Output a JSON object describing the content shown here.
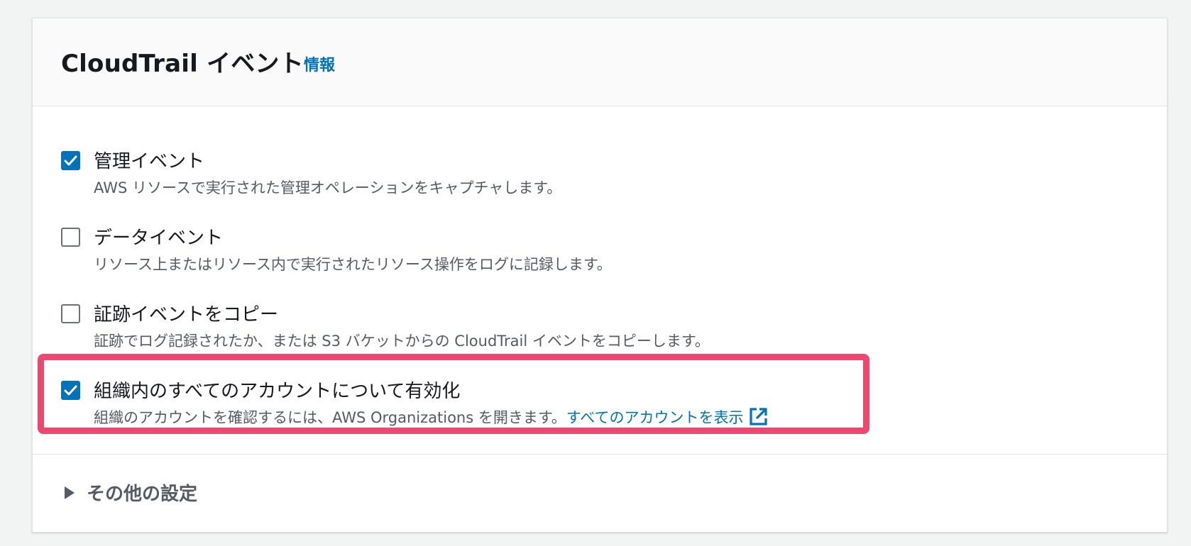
{
  "panel": {
    "title": "CloudTrail イベント",
    "info_link": "情報"
  },
  "options": [
    {
      "label": "管理イベント",
      "description": "AWS リソースで実行された管理オペレーションをキャプチャします。",
      "checked": true
    },
    {
      "label": "データイベント",
      "description": "リソース上またはリソース内で実行されたリソース操作をログに記録します。",
      "checked": false
    },
    {
      "label": "証跡イベントをコピー",
      "description": "証跡でログ記録されたか、または S3 バケットからの CloudTrail イベントをコピーします。",
      "checked": false
    },
    {
      "label": "組織内のすべてのアカウントについて有効化",
      "description": "組織のアカウントを確認するには、AWS Organizations を開きます。",
      "link": "すべてのアカウントを表示",
      "checked": true
    }
  ],
  "additional_settings": {
    "label": "その他の設定"
  },
  "icons": {
    "checkbox_checked": "check-icon",
    "external_link": "external-link-icon",
    "expander": "caret-right-icon"
  },
  "colors": {
    "accent": "#0073bb",
    "highlight": "#ef476f",
    "text": "#16191f",
    "muted": "#545b64"
  }
}
